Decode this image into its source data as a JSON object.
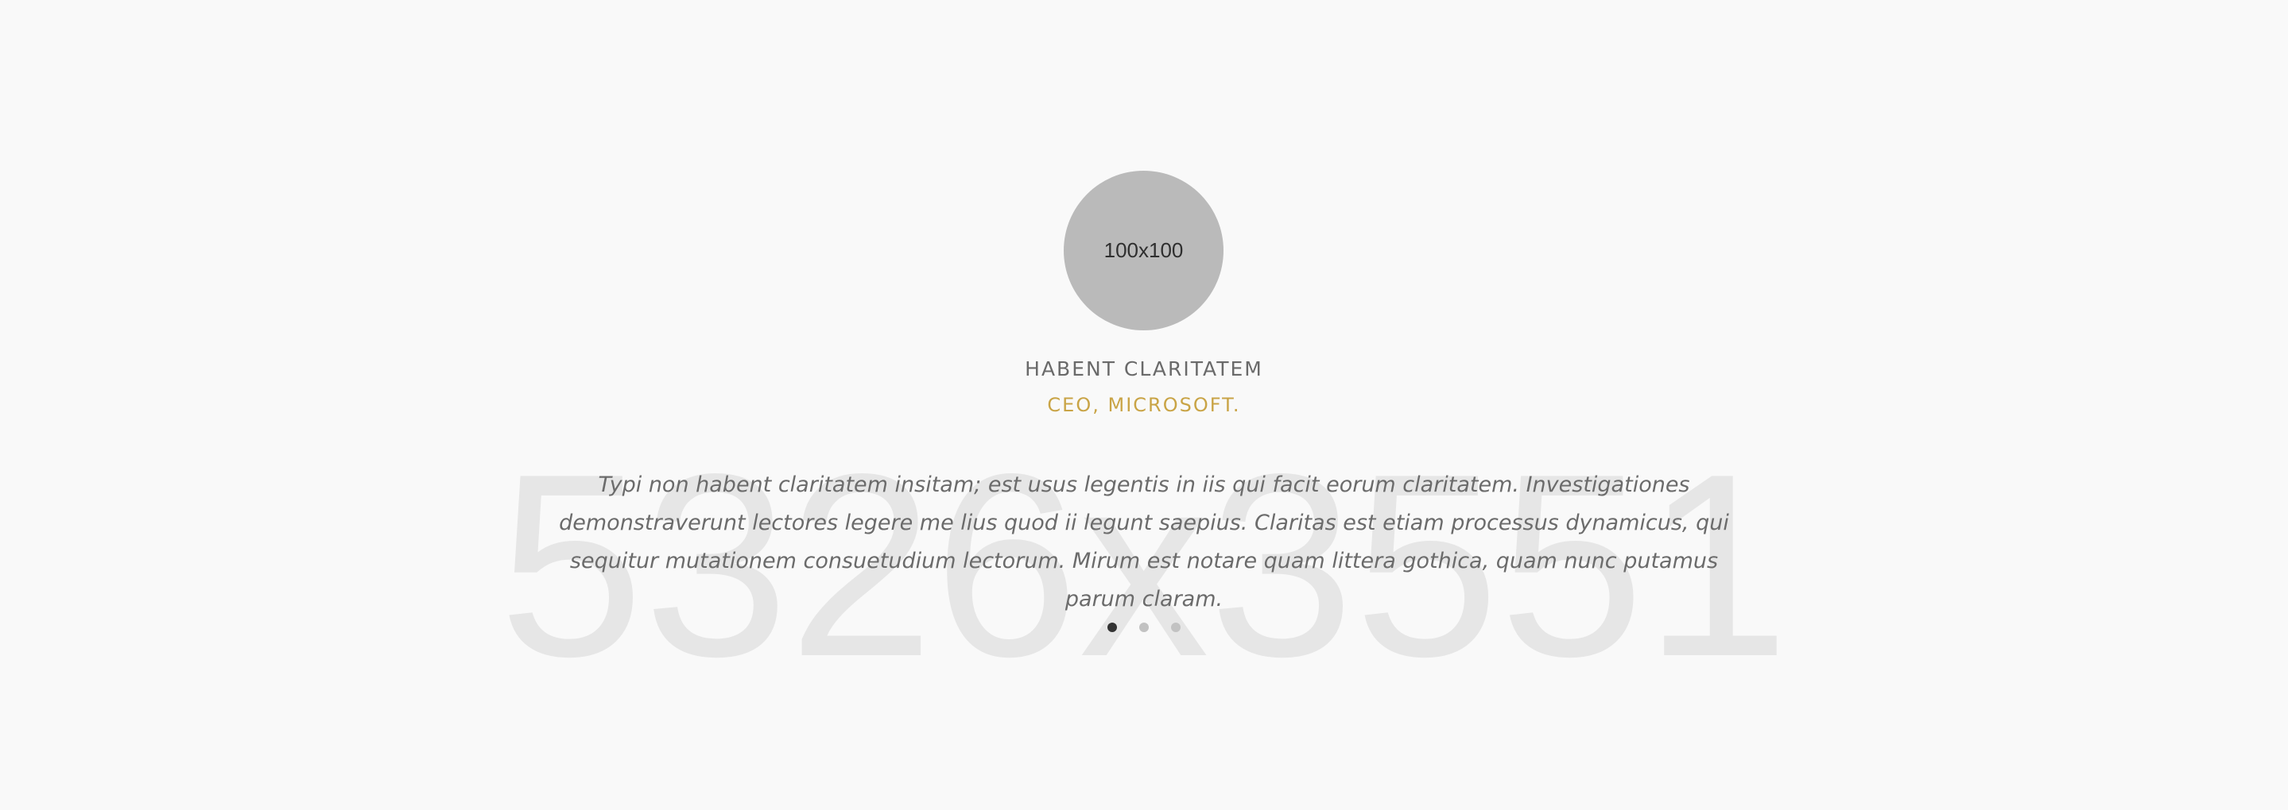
{
  "background_placeholder": {
    "label": "5326x3551"
  },
  "testimonial": {
    "avatar_label": "100x100",
    "name": "HABENT CLARITATEM",
    "role": "CEO, MICROSOFT.",
    "quote": "Typi non habent claritatem insitam; est usus legentis in iis qui facit eorum claritatem. Investigationes demonstraverunt lectores legere me lius quod ii legunt saepius. Claritas est etiam processus dynamicus, qui sequitur mutationem consuetudium lectorum. Mirum est notare quam littera gothica, quam nunc putamus parum claram."
  },
  "carousel": {
    "slide_count": 3,
    "active_index": 0
  },
  "colors": {
    "background": "#f9f9f9",
    "accent": "#c9a446",
    "text": "#6b6b6b",
    "avatar_bg": "#bababa",
    "dot_active": "#333333",
    "dot_inactive": "#c2c2c2"
  }
}
